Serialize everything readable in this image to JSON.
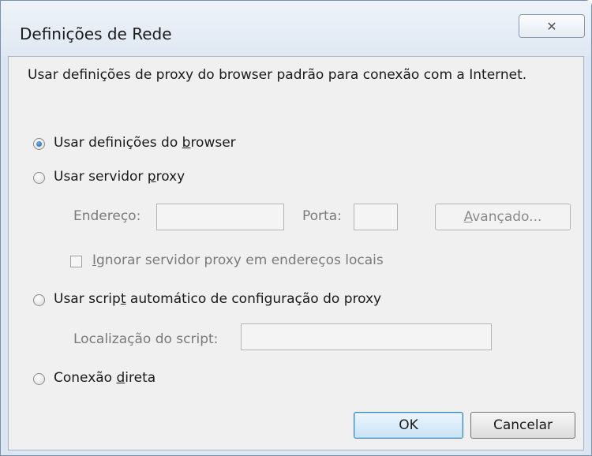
{
  "dialog": {
    "title": "Definições de Rede",
    "close_glyph": "✕",
    "description": "Usar definições de proxy do browser padrão para conexão com a Internet."
  },
  "options": {
    "browser": {
      "pre": "Usar definições do ",
      "key": "b",
      "post": "rowser",
      "selected": true
    },
    "proxy": {
      "pre": "Usar servidor ",
      "key": "p",
      "post": "roxy",
      "selected": false
    },
    "auto_script": {
      "pre": "Usar scrip",
      "key": "t",
      "post": " automático de configuração do proxy",
      "selected": false
    },
    "direct": {
      "pre": "Conexão ",
      "key": "d",
      "post": "ireta",
      "selected": false
    }
  },
  "proxy_settings": {
    "address_label": "Endereço:",
    "address_value": "",
    "port_label": "Porta:",
    "port_value": "",
    "advanced_key": "A",
    "advanced_rest": "vançado...",
    "bypass_key": "I",
    "bypass_rest": "gnorar servidor proxy em endereços locais",
    "bypass_checked": false
  },
  "script_settings": {
    "location_label": "Localização do script:",
    "location_value": ""
  },
  "buttons": {
    "ok": "OK",
    "cancel": "Cancelar"
  }
}
